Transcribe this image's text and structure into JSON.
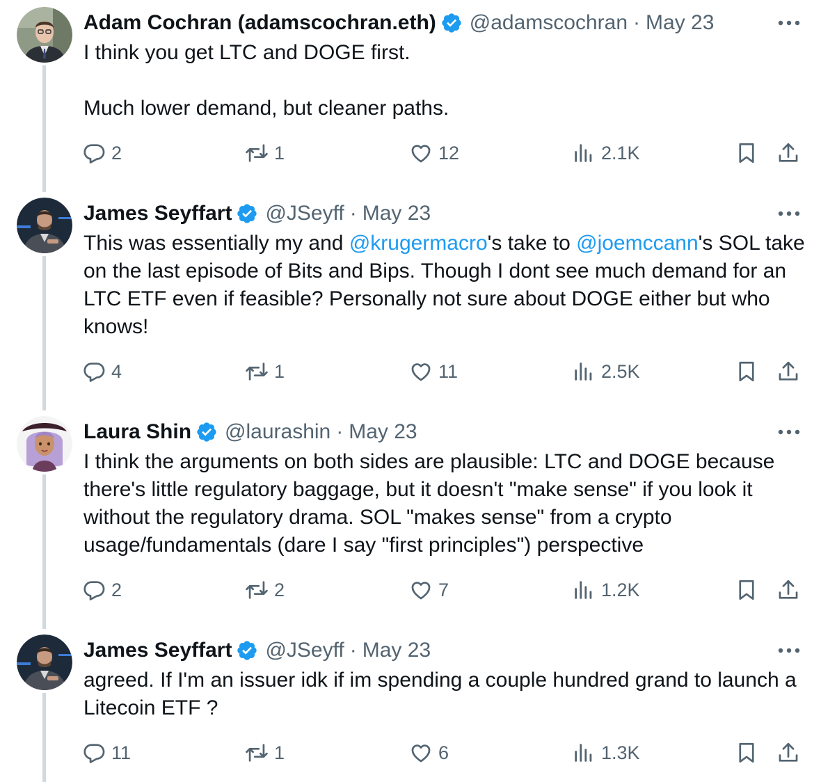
{
  "tweets": [
    {
      "name": "Adam Cochran (adamscochran.eth)",
      "handle": "@adamscochran",
      "sep": "·",
      "date": "May 23",
      "body_parts": [
        {
          "text": "I think you get LTC and DOGE first.\n\nMuch lower demand, but cleaner paths.",
          "mention": false
        }
      ],
      "replies": "2",
      "reposts": "1",
      "likes": "12",
      "views": "2.1K"
    },
    {
      "name": "James Seyffart",
      "handle": "@JSeyff",
      "sep": "·",
      "date": "May 23",
      "body_parts": [
        {
          "text": "This was essentially my and ",
          "mention": false
        },
        {
          "text": "@krugermacro",
          "mention": true
        },
        {
          "text": "'s take to ",
          "mention": false
        },
        {
          "text": "@joemccann",
          "mention": true
        },
        {
          "text": "'s SOL take on the last episode of Bits and Bips. Though I dont see much demand for an LTC ETF even if feasible? Personally not sure about DOGE either but who knows!",
          "mention": false
        }
      ],
      "replies": "4",
      "reposts": "1",
      "likes": "11",
      "views": "2.5K"
    },
    {
      "name": "Laura Shin",
      "handle": "@laurashin",
      "sep": "·",
      "date": "May 23",
      "body_parts": [
        {
          "text": "I think the arguments on both sides are plausible: LTC and DOGE because there's little regulatory baggage, but it doesn't \"make sense\" if you look it without the regulatory drama. SOL \"makes sense\" from a crypto usage/fundamentals (dare I say \"first principles\") perspective",
          "mention": false
        }
      ],
      "replies": "2",
      "reposts": "2",
      "likes": "7",
      "views": "1.2K"
    },
    {
      "name": "James Seyffart",
      "handle": "@JSeyff",
      "sep": "·",
      "date": "May 23",
      "body_parts": [
        {
          "text": "agreed. If I'm an issuer idk if im spending a couple hundred grand to launch a Litecoin ETF ?",
          "mention": false
        }
      ],
      "replies": "11",
      "reposts": "1",
      "likes": "6",
      "views": "1.3K"
    }
  ],
  "icons": {
    "verified": "verified-badge-icon",
    "more": "more-dots-icon",
    "reply": "reply-icon",
    "retweet": "retweet-icon",
    "like": "heart-icon",
    "views": "views-bar-chart-icon",
    "bookmark": "bookmark-icon",
    "share": "share-icon"
  },
  "colors": {
    "text": "#0f1419",
    "secondary": "#536471",
    "link": "#1d9bf0",
    "verified": "#1d9bf0",
    "thread_line": "#cfd9de"
  }
}
